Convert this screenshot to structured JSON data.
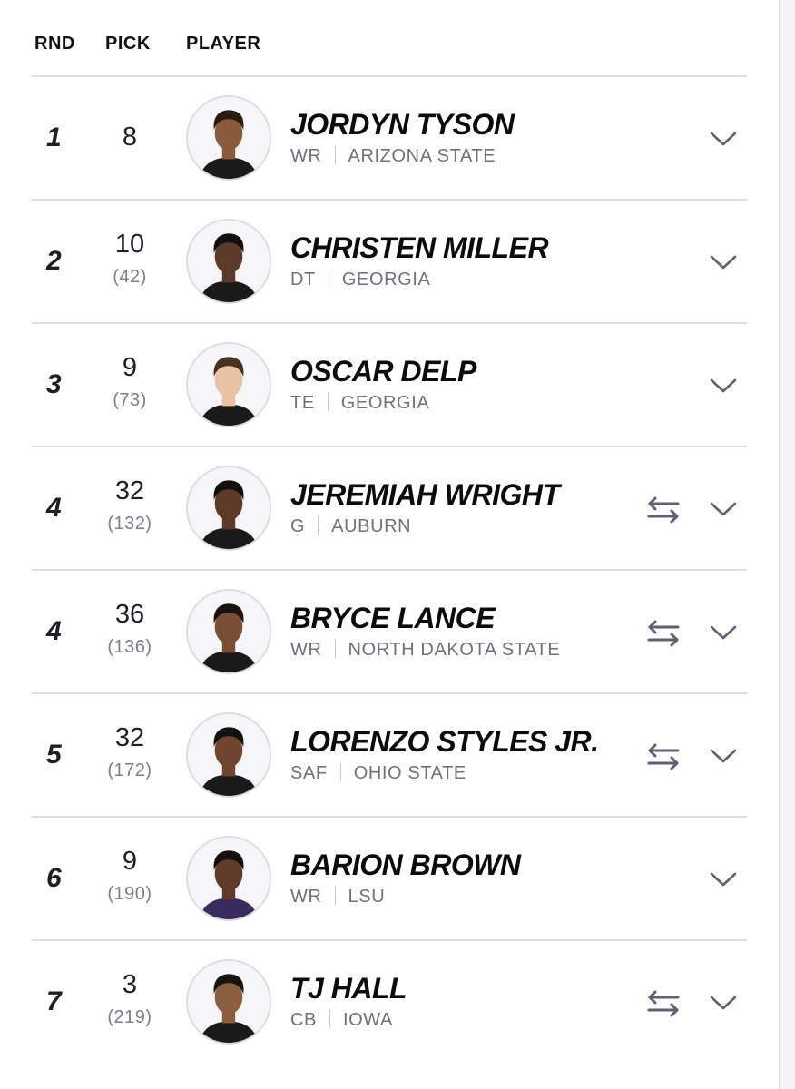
{
  "header": {
    "rnd": "RND",
    "pick": "PICK",
    "player": "PLAYER"
  },
  "picks": [
    {
      "rnd": "1",
      "pick": "8",
      "overall": "",
      "name": "JORDYN TYSON",
      "pos": "WR",
      "school": "ARIZONA STATE",
      "traded": false,
      "skin": "#8a5a3c",
      "hair": "#2b1c12",
      "shirt": "#1a1a1a"
    },
    {
      "rnd": "2",
      "pick": "10",
      "overall": "(42)",
      "name": "CHRISTEN MILLER",
      "pos": "DT",
      "school": "GEORGIA",
      "traded": false,
      "skin": "#5a3a28",
      "hair": "#151010",
      "shirt": "#1a1a1a"
    },
    {
      "rnd": "3",
      "pick": "9",
      "overall": "(73)",
      "name": "OSCAR DELP",
      "pos": "TE",
      "school": "GEORGIA",
      "traded": false,
      "skin": "#e8c2a5",
      "hair": "#4a3220",
      "shirt": "#1a1a1a"
    },
    {
      "rnd": "4",
      "pick": "32",
      "overall": "(132)",
      "name": "JEREMIAH WRIGHT",
      "pos": "G",
      "school": "AUBURN",
      "traded": true,
      "skin": "#5b3a27",
      "hair": "#141010",
      "shirt": "#1a1a1a"
    },
    {
      "rnd": "4",
      "pick": "36",
      "overall": "(136)",
      "name": "BRYCE LANCE",
      "pos": "WR",
      "school": "NORTH DAKOTA STATE",
      "traded": true,
      "skin": "#7a4e34",
      "hair": "#1a1210",
      "shirt": "#1a1a1a"
    },
    {
      "rnd": "5",
      "pick": "32",
      "overall": "(172)",
      "name": "LORENZO STYLES JR.",
      "pos": "SAF",
      "school": "OHIO STATE",
      "traded": true,
      "skin": "#6e4630",
      "hair": "#151010",
      "shirt": "#1a1a1a"
    },
    {
      "rnd": "6",
      "pick": "9",
      "overall": "(190)",
      "name": "BARION BROWN",
      "pos": "WR",
      "school": "LSU",
      "traded": false,
      "skin": "#5e3c29",
      "hair": "#151010",
      "shirt": "#3b2a5c"
    },
    {
      "rnd": "7",
      "pick": "3",
      "overall": "(219)",
      "name": "TJ HALL",
      "pos": "CB",
      "school": "IOWA",
      "traded": true,
      "skin": "#8b5e40",
      "hair": "#181210",
      "shirt": "#1a1a1a"
    }
  ],
  "icons": {
    "trade": "swap-arrows-icon",
    "expand": "chevron-down-icon",
    "avatar": "player-headshot"
  },
  "colors": {
    "divider": "#dfe1e6",
    "muted": "#6e727c",
    "icon": "#5d6270"
  }
}
